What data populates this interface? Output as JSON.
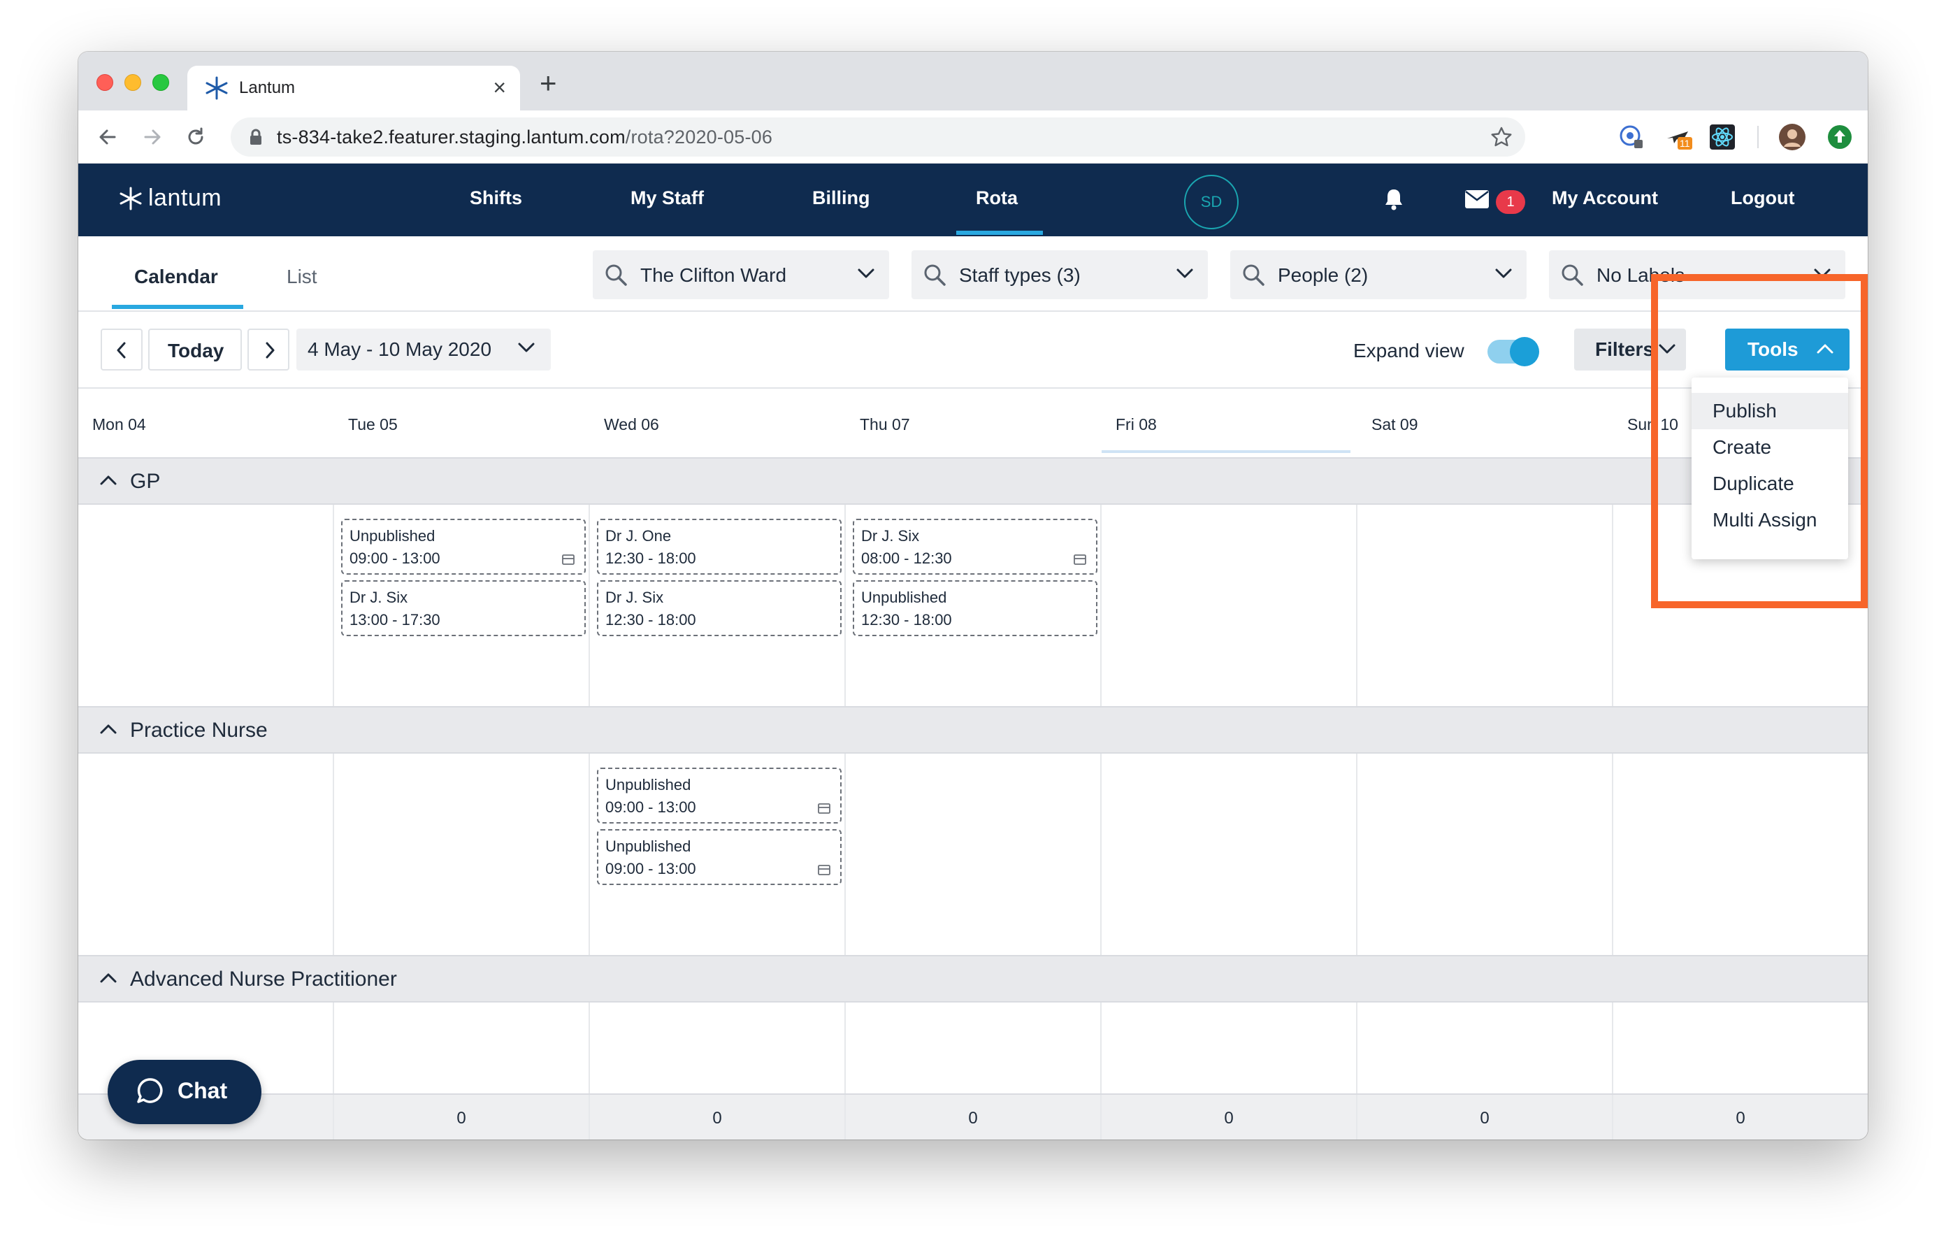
{
  "browser": {
    "tab_title": "Lantum",
    "url_host": "ts-834-take2.featurer.staging.lantum.com",
    "url_path": "/rota?2020-05-06",
    "extension_badge": "11"
  },
  "nav": {
    "logo_text": "lantum",
    "items": [
      "Shifts",
      "My Staff",
      "Billing",
      "Rota"
    ],
    "active": "Rota",
    "avatar_initials": "SD",
    "mail_count": "1",
    "my_account": "My Account",
    "logout": "Logout"
  },
  "subtabs": {
    "calendar": "Calendar",
    "list": "List"
  },
  "filters": {
    "ward": "The Clifton Ward",
    "staff_types": "Staff types (3)",
    "people": "People (2)",
    "labels": "No Labels"
  },
  "toolbar": {
    "today": "Today",
    "date_range": "4 May - 10 May 2020",
    "expand_view": "Expand view",
    "expand_on": true,
    "filters": "Filters",
    "tools": "Tools"
  },
  "tools_menu": [
    "Publish",
    "Create",
    "Duplicate",
    "Multi Assign"
  ],
  "days": [
    "Mon 04",
    "Tue 05",
    "Wed 06",
    "Thu 07",
    "Fri 08",
    "Sat 09",
    "Sun 10"
  ],
  "groups": {
    "gp": {
      "title": "GP",
      "shifts": [
        {
          "name": "Unpublished",
          "time": "09:00 - 13:00"
        },
        {
          "name": "Dr J. Six",
          "time": "13:00 - 17:30"
        },
        {
          "name": "Dr J. One",
          "time": "12:30 - 18:00"
        },
        {
          "name": "Dr J. Six",
          "time": "12:30 - 18:00"
        },
        {
          "name": "Dr J. Six",
          "time": "08:00 - 12:30"
        },
        {
          "name": "Unpublished",
          "time": "12:30 - 18:00"
        }
      ]
    },
    "nurse": {
      "title": "Practice Nurse",
      "shifts": [
        {
          "name": "Unpublished",
          "time": "09:00 - 13:00"
        },
        {
          "name": "Unpublished",
          "time": "09:00 - 13:00"
        }
      ]
    },
    "anp": {
      "title": "Advanced Nurse Practitioner"
    }
  },
  "footer_counts": [
    "0",
    "0",
    "0",
    "0",
    "0",
    "0"
  ],
  "chat": "Chat",
  "colors": {
    "navy": "#0f2b4f",
    "accent": "#1e9bd7",
    "highlight": "#f7652a",
    "badge": "#e8394a"
  }
}
